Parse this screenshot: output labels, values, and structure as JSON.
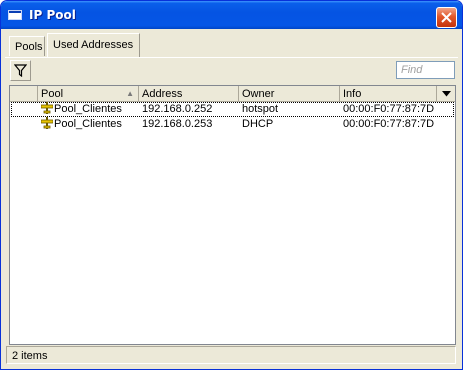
{
  "window": {
    "title": "IP Pool",
    "icon": "window-icon",
    "colors": {
      "titlebar": "#0554e3",
      "close": "#e2582a",
      "face": "#ece9d8"
    }
  },
  "tabs": [
    {
      "label": "Pools",
      "active": false
    },
    {
      "label": "Used Addresses",
      "active": true
    }
  ],
  "toolbar": {
    "filter_icon": "filter-icon",
    "find_placeholder": "Find",
    "find_value": ""
  },
  "table": {
    "columns": [
      "Pool",
      "Address",
      "Owner",
      "Info"
    ],
    "sort_column": "Pool",
    "rows": [
      {
        "pool": "Pool_Clientes",
        "address": "192.168.0.252",
        "owner": "hotspot",
        "info": "00:00:F0:77:87:7D",
        "selected": true
      },
      {
        "pool": "Pool_Clientes",
        "address": "192.168.0.253",
        "owner": "DHCP",
        "info": "00:00:F0:77:87:7D",
        "selected": false
      }
    ]
  },
  "status": {
    "count_text": "2 items"
  }
}
